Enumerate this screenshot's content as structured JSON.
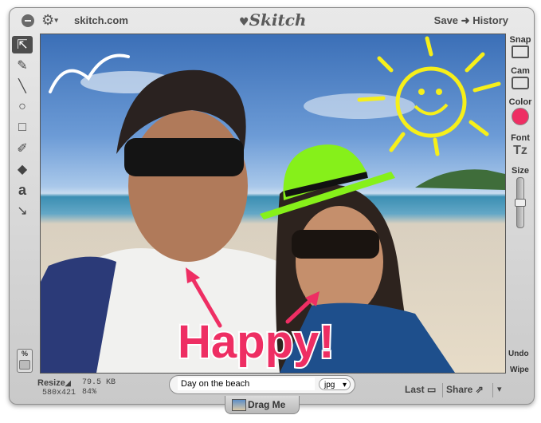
{
  "titlebar": {
    "site": "skitch.com",
    "logo": "Skitch",
    "save": "Save",
    "arrow": "➜",
    "history": "History"
  },
  "left_tools": [
    {
      "name": "select-move-tool-icon",
      "glyph": "⇱"
    },
    {
      "name": "pencil-tool-icon",
      "glyph": "✎"
    },
    {
      "name": "line-tool-icon",
      "glyph": "╲"
    },
    {
      "name": "ellipse-tool-icon",
      "glyph": "○"
    },
    {
      "name": "rectangle-tool-icon",
      "glyph": "□"
    },
    {
      "name": "highlighter-tool-icon",
      "glyph": "✐"
    },
    {
      "name": "eraser-tool-icon",
      "glyph": "◆"
    },
    {
      "name": "text-tool-icon",
      "glyph": "a"
    },
    {
      "name": "arrow-tool-icon",
      "glyph": "↘"
    }
  ],
  "right_tools": {
    "snap": "Snap",
    "cam": "Cam",
    "color": "Color",
    "color_value": "#ee2e63",
    "font": "Font",
    "font_glyph": "Tz",
    "size": "Size",
    "size_level": 0.5
  },
  "zoom_label": "%",
  "undo": "Undo",
  "wipe": "Wipe",
  "canvas": {
    "annotation_text": "Happy!",
    "annotation_color": "#ee2e63",
    "sun_color": "#f6ef1a",
    "hat_color": "#86f01a"
  },
  "bottom": {
    "resize": "Resize",
    "dimensions": "580x421",
    "filesize": "79.5 KB",
    "quality": "84%",
    "filename": "Day on the beach",
    "format": "jpg",
    "drag": "Drag Me",
    "last": "Last",
    "share": "Share",
    "share_dropdown": "▾"
  }
}
